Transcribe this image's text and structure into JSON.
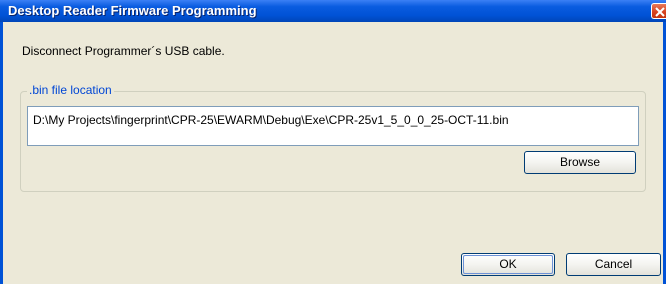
{
  "window": {
    "title": "Desktop Reader Firmware Programming",
    "close_icon": "close-icon"
  },
  "message": "Disconnect Programmer´s USB cable.",
  "bin_group": {
    "legend": ".bin file location",
    "path_value": "D:\\My Projects\\fingerprint\\CPR-25\\EWARM\\Debug\\Exe\\CPR-25v1_5_0_0_25-OCT-11.bin",
    "browse_label": "Browse"
  },
  "footer": {
    "ok_label": "OK",
    "cancel_label": "Cancel"
  },
  "colors": {
    "titlebar": "#0052d6",
    "dialog_bg": "#ece9d8",
    "legend_text": "#0046d5",
    "close_button": "#d6401e"
  }
}
